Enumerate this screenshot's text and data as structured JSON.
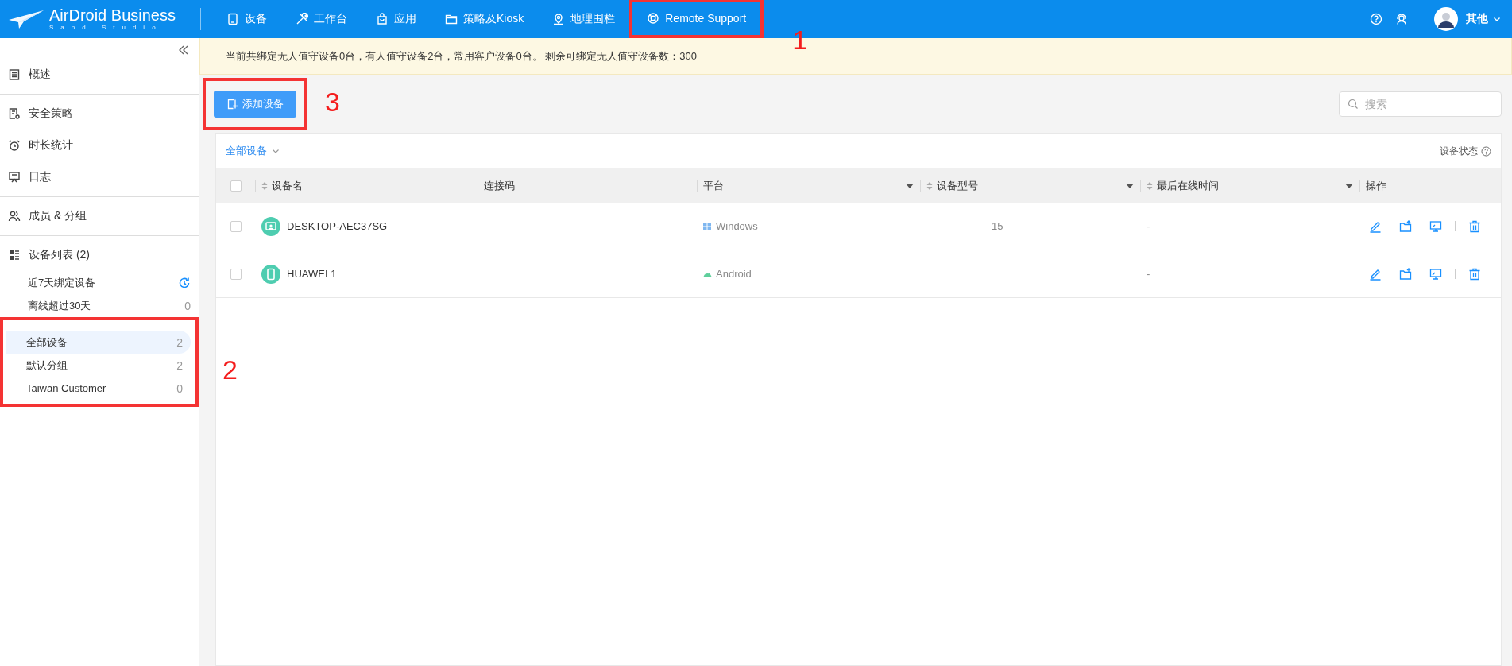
{
  "header": {
    "logo_title": "AirDroid Business",
    "logo_subtitle": "Sand Studio",
    "nav": [
      {
        "label": "设备",
        "selected": false
      },
      {
        "label": "工作台",
        "selected": false
      },
      {
        "label": "应用",
        "selected": false
      },
      {
        "label": "策略及Kiosk",
        "selected": false
      },
      {
        "label": "地理围栏",
        "selected": false
      },
      {
        "label": "Remote Support",
        "selected": false,
        "annotation": "1"
      }
    ],
    "user": {
      "name": "其他"
    }
  },
  "sidebar": {
    "sections": [
      [
        {
          "label": "概述"
        }
      ],
      [
        {
          "label": "安全策略"
        },
        {
          "label": "时长统计"
        },
        {
          "label": "日志"
        }
      ],
      [
        {
          "label": "成员 & 分组"
        }
      ]
    ],
    "device_list": {
      "label": "设备列表 (2)",
      "filters": [
        {
          "label": "近7天绑定设备",
          "kind": "clock"
        },
        {
          "label": "离线超过30天",
          "kind": "count",
          "count": "0"
        }
      ],
      "groups": {
        "annotation": "2",
        "items": [
          {
            "label": "全部设备",
            "count": "2",
            "selected": true
          },
          {
            "label": "默认分组",
            "count": "2",
            "selected": false
          },
          {
            "label": "Taiwan Customer",
            "count": "0",
            "selected": false
          }
        ]
      }
    }
  },
  "notice": "当前共绑定无人值守设备0台，有人值守设备2台，常用客户设备0台。 剩余可绑定无人值守设备数：300",
  "toolbar": {
    "add_button": {
      "label": "添加设备",
      "annotation": "3"
    },
    "search": {
      "placeholder": "搜索"
    }
  },
  "table": {
    "filter": "全部设备",
    "status_label": "设备状态",
    "header_checked": false,
    "columns": [
      {
        "label": "设备名",
        "sortable": true,
        "filterable": false
      },
      {
        "label": "连接码",
        "sortable": false,
        "filterable": false
      },
      {
        "label": "平台",
        "sortable": false,
        "filterable": true
      },
      {
        "label": "设备型号",
        "sortable": true,
        "filterable": true
      },
      {
        "label": "最后在线时间",
        "sortable": true,
        "filterable": true
      },
      {
        "label": "操作",
        "sortable": false,
        "filterable": false
      }
    ],
    "rows": [
      {
        "checked": false,
        "kind": "windows",
        "name": "DESKTOP-AEC37SG",
        "platform": "Windows",
        "model": "15",
        "last_online": "-"
      },
      {
        "checked": false,
        "kind": "android",
        "name": "HUAWEI 1",
        "platform": "Android",
        "last_online": "-"
      }
    ]
  }
}
